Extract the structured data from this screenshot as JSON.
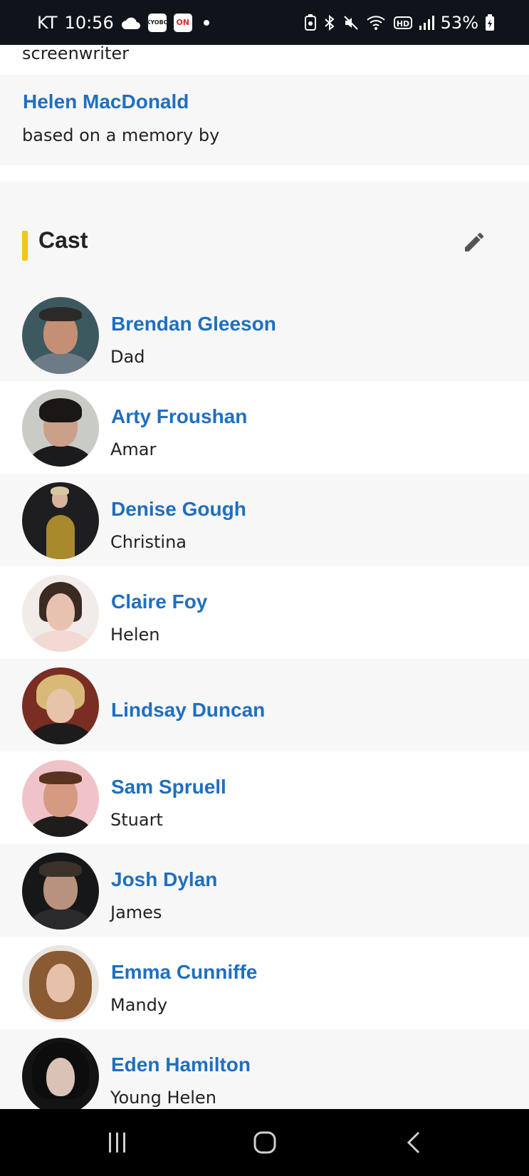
{
  "status_bar": {
    "carrier": "KT",
    "time": "10:56",
    "chip1": "KYOBO",
    "chip2": "ON",
    "battery": "53%"
  },
  "credits": {
    "previous_role": "screenwriter",
    "name": "Helen MacDonald",
    "role": "based on a memory by"
  },
  "cast": {
    "title": "Cast",
    "accent_color": "#f5c518",
    "link_color": "#1f6fbf",
    "members": [
      {
        "name": "Brendan Gleeson",
        "character": "Dad"
      },
      {
        "name": "Arty Froushan",
        "character": "Amar"
      },
      {
        "name": "Denise Gough",
        "character": "Christina"
      },
      {
        "name": "Claire Foy",
        "character": "Helen"
      },
      {
        "name": "Lindsay Duncan",
        "character": ""
      },
      {
        "name": "Sam Spruell",
        "character": "Stuart"
      },
      {
        "name": "Josh Dylan",
        "character": "James"
      },
      {
        "name": "Emma Cunniffe",
        "character": "Mandy"
      },
      {
        "name": "Eden Hamilton",
        "character": "Young Helen"
      }
    ]
  },
  "icons": {
    "edit": "pencil-icon",
    "nav_recents": "recents-icon",
    "nav_home": "home-icon",
    "nav_back": "back-icon"
  }
}
